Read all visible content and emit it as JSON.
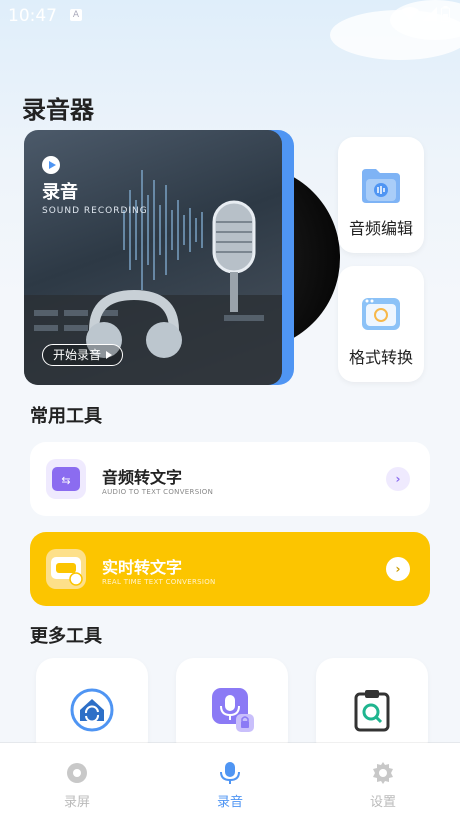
{
  "status_bar": {
    "time": "10:47",
    "notification_badge": "A"
  },
  "page_title": "录音器",
  "hero": {
    "title": "录音",
    "subtitle": "SOUND RECORDING",
    "start_button": "开始录音",
    "accent": "#4f95f3"
  },
  "side_cards": [
    {
      "label": "音频编辑",
      "icon": "audio-folder-icon"
    },
    {
      "label": "格式转换",
      "icon": "format-convert-icon"
    }
  ],
  "common_tools": {
    "title": "常用工具",
    "items": [
      {
        "title": "音频转文字",
        "subtitle": "AUDIO TO TEXT CONVERSION",
        "icon": "audio-to-text-icon",
        "background": "#ffffff",
        "accent": "#8b6cf0"
      },
      {
        "title": "实时转文字",
        "subtitle": "REAL TIME TEXT CONVERSION",
        "icon": "realtime-text-icon",
        "background": "#fcc500",
        "accent": "#ffffff"
      }
    ]
  },
  "more_tools": {
    "title": "更多工具",
    "items": [
      {
        "icon": "home-sync-icon"
      },
      {
        "icon": "locked-mic-icon"
      },
      {
        "icon": "clipboard-search-icon"
      }
    ]
  },
  "tab_bar": {
    "tabs": [
      {
        "label": "录屏",
        "icon": "screen-record-icon",
        "active": false
      },
      {
        "label": "录音",
        "icon": "mic-icon",
        "active": true
      },
      {
        "label": "设置",
        "icon": "settings-gear-icon",
        "active": false
      }
    ]
  }
}
